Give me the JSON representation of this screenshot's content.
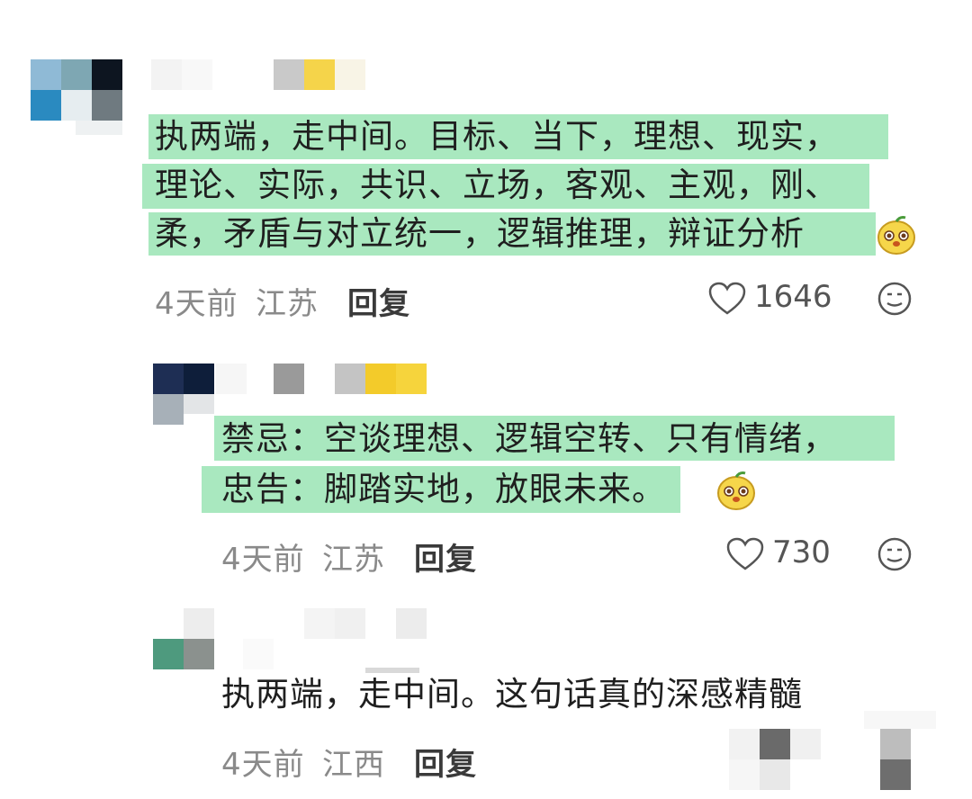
{
  "comments": [
    {
      "lines": [
        "执两端，走中间。目标、当下，理想、现实，",
        "理论、实际，共识、立场，客观、主观，刚、",
        "柔，矛盾与对立统一，逻辑推理，辩证分析"
      ],
      "time": "4天前",
      "location": "江苏",
      "reply_label": "回复",
      "likes": "1646"
    },
    {
      "lines": [
        "禁忌：空谈理想、逻辑空转、只有情绪，",
        "忠告：脚踏实地，放眼未来。"
      ],
      "time": "4天前",
      "location": "江苏",
      "reply_label": "回复",
      "likes": "730"
    },
    {
      "lines": [
        "执两端，走中间。这句话真的深感精髓"
      ],
      "time": "4天前",
      "location": "江西",
      "reply_label": "回复"
    }
  ],
  "colors": {
    "highlight": "#a9e8bf",
    "text": "#1f1f1f",
    "meta": "#8a8a8a"
  },
  "icons": [
    "heart-icon",
    "reaction-face-icon",
    "emoji-sticker-icon"
  ]
}
